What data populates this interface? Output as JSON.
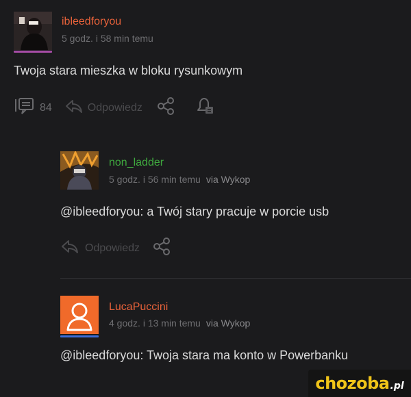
{
  "comment": {
    "author": "ibleedforyou",
    "author_color": "#e8623a",
    "time": "5 godz. i 58 min temu",
    "text": "Twoja stara mieszka w bloku rysunkowym",
    "reply_count": "84",
    "reply_label": "Odpowiedz"
  },
  "replies": [
    {
      "author": "non_ladder",
      "author_color": "#3faa3f",
      "time": "5 godz. i 56 min temu",
      "via": "via Wykop",
      "text": "@ibleedforyou: a Twój stary pracuje w porcie usb",
      "reply_label": "Odpowiedz"
    },
    {
      "author": "LucaPuccini",
      "author_color": "#e8623a",
      "time": "4 godz. i 13 min temu",
      "via": "via Wykop",
      "text": "@ibleedforyou: Twoja stara ma konto w Powerbanku"
    }
  ],
  "watermark": {
    "main": "chozoba",
    "tld": ".pl"
  },
  "colors": {
    "background": "#1b1b1d",
    "avatar_bar_purple": "#a64ca6",
    "avatar_bar_blue": "#3b6ed8",
    "placeholder_avatar": "#f06a2a",
    "watermark_yellow": "#f0c419"
  },
  "icons": [
    "comments-icon",
    "reply-arrow-icon",
    "share-icon",
    "notification-bell-icon",
    "default-user-icon"
  ]
}
